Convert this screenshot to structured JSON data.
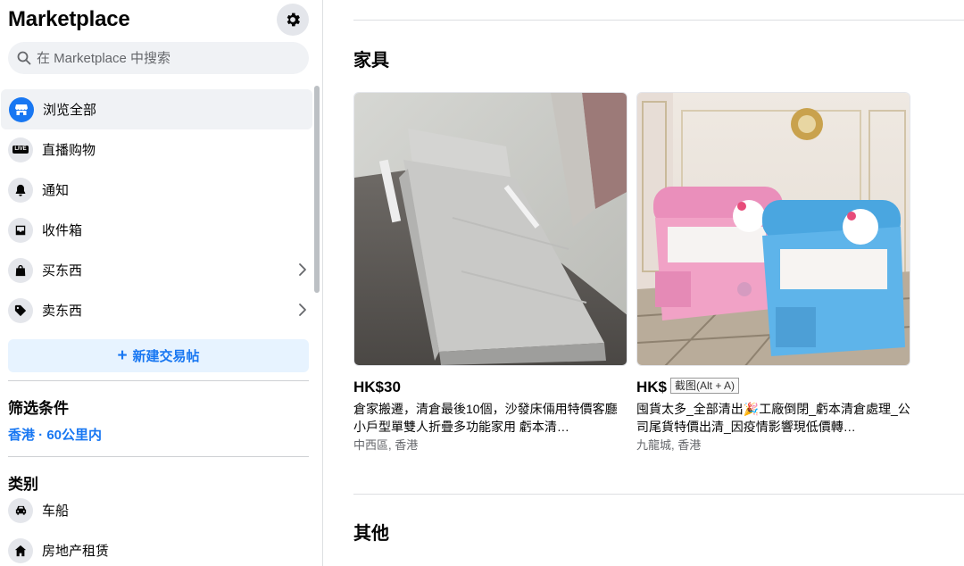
{
  "sidebar": {
    "title": "Marketplace",
    "settings_icon": "gear-icon",
    "search": {
      "placeholder": "在 Marketplace 中搜索",
      "value": ""
    },
    "nav_items": [
      {
        "label": "浏览全部",
        "icon": "storefront-icon",
        "active": true
      },
      {
        "label": "直播购物",
        "icon": "live-icon",
        "badge": "LIVE"
      },
      {
        "label": "通知",
        "icon": "bell-icon"
      },
      {
        "label": "收件箱",
        "icon": "inbox-icon"
      },
      {
        "label": "买东西",
        "icon": "shopping-bag-icon",
        "has_chevron": true
      },
      {
        "label": "卖东西",
        "icon": "price-tag-icon",
        "has_chevron": true
      }
    ],
    "create_listing_label": "新建交易帖",
    "filters": {
      "heading": "筛选条件",
      "location": "香港 · 60公里内"
    },
    "categories": {
      "heading": "类别",
      "items": [
        {
          "label": "车船",
          "icon": "car-icon"
        },
        {
          "label": "房地产租赁",
          "icon": "house-icon"
        }
      ]
    }
  },
  "main": {
    "section_furniture": "家具",
    "section_other": "其他",
    "listings": [
      {
        "price": "HK$30",
        "title": "倉家搬遷，清倉最後10個，沙發床倆用特價客廳小戶型單雙人折疊多功能家用 虧本清…",
        "location": "中西區, 香港"
      },
      {
        "price": "HK$",
        "title": "囤貨太多_全部清出🎉工廠倒閉_虧本清倉處理_公司尾貨特價出清_因疫情影響現低價轉…",
        "location": "九龍城, 香港"
      }
    ],
    "tooltip": "截图(Alt + A)"
  },
  "colors": {
    "accent": "#1877f2",
    "accent_light": "#e7f3ff",
    "text_secondary": "#65676b",
    "divider": "#dddfe2"
  }
}
